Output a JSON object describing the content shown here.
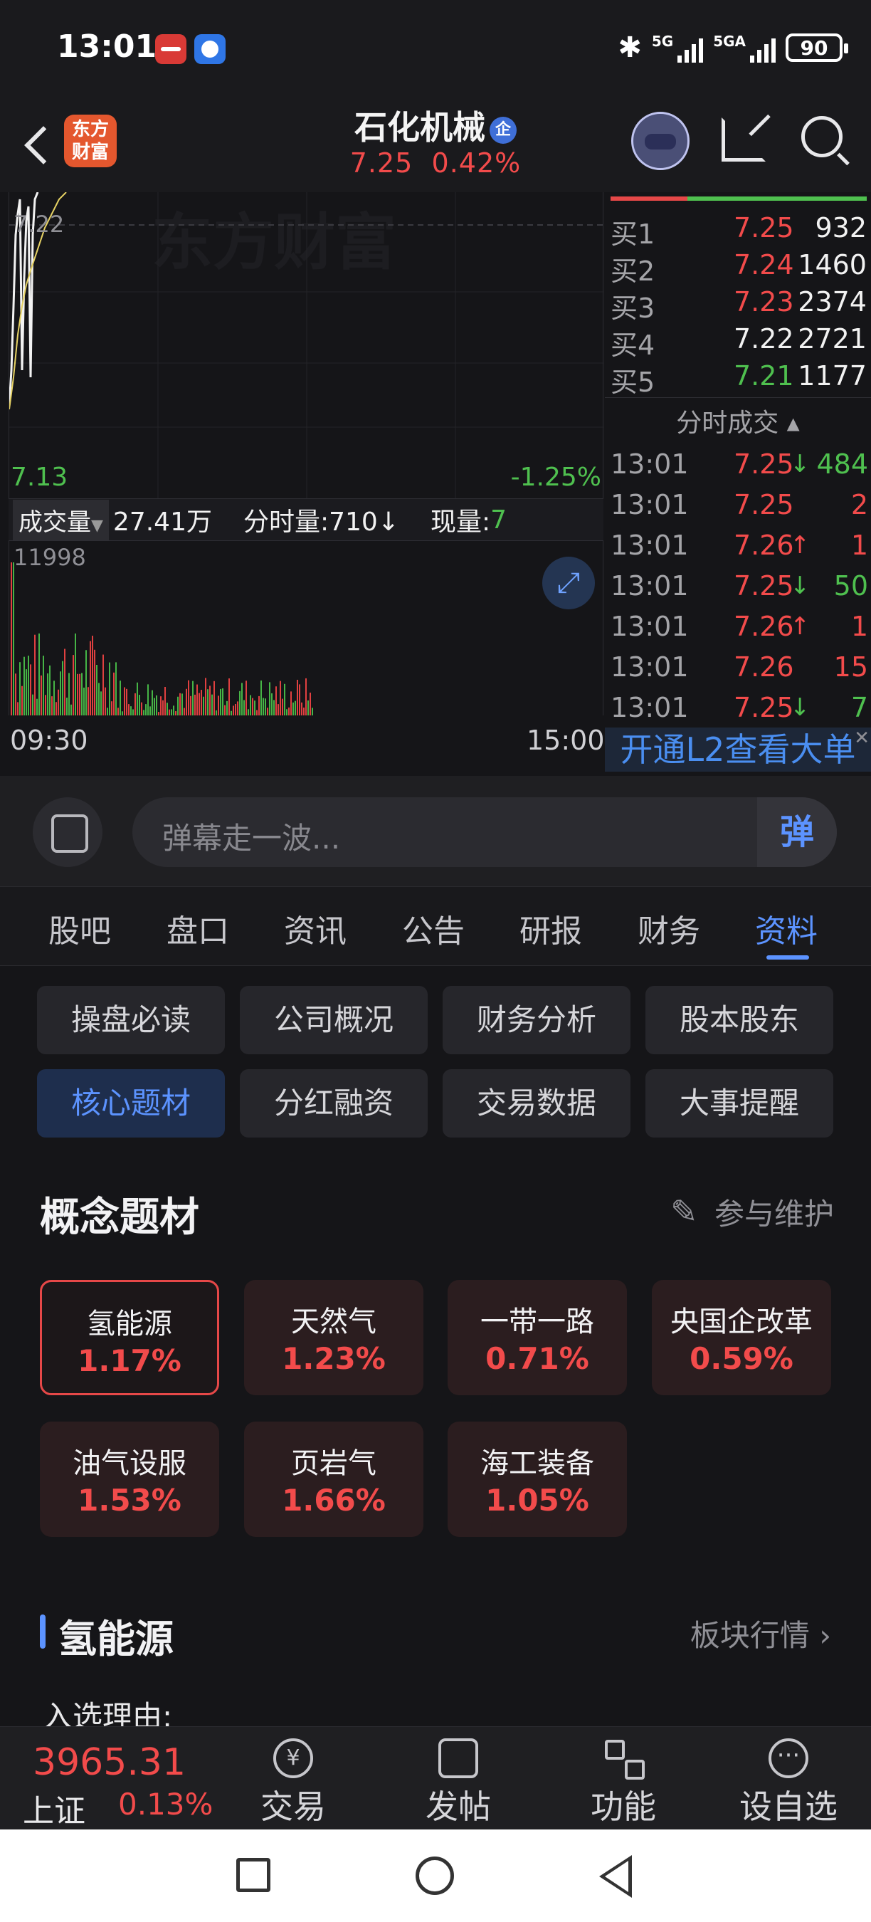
{
  "status_bar": {
    "time": "13:01",
    "battery": "90",
    "net1": "5G",
    "net2": "5GA"
  },
  "header": {
    "stock_name": "石化机械",
    "badge": "企",
    "price": "7.25",
    "change_pct": "0.42%",
    "logo_line1": "东方",
    "logo_line2": "财富"
  },
  "chart": {
    "watermark": "东方财富",
    "ref_price": "7.22",
    "low_price": "7.13",
    "low_pct": "-1.25%",
    "volume_label": "成交量",
    "volume_value": "27.41万",
    "tick_volume_label": "分时量:710↓",
    "current_volume_label": "现量:",
    "current_volume_value": "7",
    "volume_max": "11998",
    "time_start": "09:30",
    "time_end": "15:00"
  },
  "order_book": {
    "bids": [
      {
        "label": "买1",
        "price": "7.25",
        "volume": "932",
        "color": "#f24b4b"
      },
      {
        "label": "买2",
        "price": "7.24",
        "volume": "1460",
        "color": "#f24b4b"
      },
      {
        "label": "买3",
        "price": "7.23",
        "volume": "2374",
        "color": "#f24b4b"
      },
      {
        "label": "买4",
        "price": "7.22",
        "volume": "2721",
        "color": "#f2f2f2"
      },
      {
        "label": "买5",
        "price": "7.21",
        "volume": "1177",
        "color": "#4fc04f"
      }
    ],
    "trades_header": "分时成交 ▴",
    "trades": [
      {
        "time": "13:01",
        "price": "7.25",
        "arrow": "↓",
        "volume": "484",
        "color": "#f24b4b",
        "vol_color": "#4fc04f",
        "arrow_color": "#4fc04f"
      },
      {
        "time": "13:01",
        "price": "7.25",
        "arrow": "",
        "volume": "2",
        "color": "#f24b4b",
        "vol_color": "#f24b4b",
        "arrow_color": "#f24b4b"
      },
      {
        "time": "13:01",
        "price": "7.26",
        "arrow": "↑",
        "volume": "1",
        "color": "#f24b4b",
        "vol_color": "#f24b4b",
        "arrow_color": "#f24b4b"
      },
      {
        "time": "13:01",
        "price": "7.25",
        "arrow": "↓",
        "volume": "50",
        "color": "#f24b4b",
        "vol_color": "#4fc04f",
        "arrow_color": "#4fc04f"
      },
      {
        "time": "13:01",
        "price": "7.26",
        "arrow": "↑",
        "volume": "1",
        "color": "#f24b4b",
        "vol_color": "#f24b4b",
        "arrow_color": "#f24b4b"
      },
      {
        "time": "13:01",
        "price": "7.26",
        "arrow": "",
        "volume": "15",
        "color": "#f24b4b",
        "vol_color": "#f24b4b",
        "arrow_color": "#f24b4b"
      },
      {
        "time": "13:01",
        "price": "7.25",
        "arrow": "↓",
        "volume": "7",
        "color": "#f24b4b",
        "vol_color": "#4fc04f",
        "arrow_color": "#4fc04f"
      }
    ],
    "l2_link": "开通L2查看大单"
  },
  "comment": {
    "placeholder": "弹幕走一波...",
    "button": "弹"
  },
  "tabs": [
    {
      "label": "股吧"
    },
    {
      "label": "盘口"
    },
    {
      "label": "资讯"
    },
    {
      "label": "公告"
    },
    {
      "label": "研报"
    },
    {
      "label": "财务"
    },
    {
      "label": "资料"
    }
  ],
  "sub_menu": [
    "操盘必读",
    "公司概况",
    "财务分析",
    "股本股东",
    "核心题材",
    "分红融资",
    "交易数据",
    "大事提醒"
  ],
  "concepts": {
    "title": "概念题材",
    "maintain": "参与维护",
    "items": [
      {
        "name": "氢能源",
        "pct": "1.17%"
      },
      {
        "name": "天然气",
        "pct": "1.23%"
      },
      {
        "name": "一带一路",
        "pct": "0.71%"
      },
      {
        "name": "央国企改革",
        "pct": "0.59%"
      },
      {
        "name": "油气设服",
        "pct": "1.53%"
      },
      {
        "name": "页岩气",
        "pct": "1.66%"
      },
      {
        "name": "海工装备",
        "pct": "1.05%"
      }
    ]
  },
  "block": {
    "title": "氢能源",
    "link": "板块行情 ›",
    "desc": "入选理由:"
  },
  "bottom_bar": {
    "index_value": "3965.31",
    "index_name": "上证",
    "index_pct": "0.13%",
    "nav": [
      {
        "label": "交易"
      },
      {
        "label": "发帖"
      },
      {
        "label": "功能"
      },
      {
        "label": "设自选"
      }
    ]
  }
}
